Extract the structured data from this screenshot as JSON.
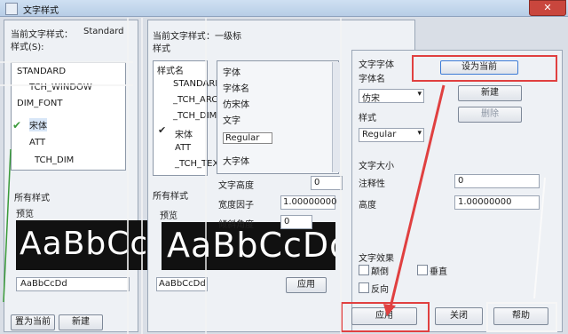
{
  "window": {
    "title": "文字样式",
    "close_glyph": "✕"
  },
  "left": {
    "current_label": "当前文字样式：",
    "current_value": "Standard",
    "styles_label": "样式(S):",
    "styles": [
      "STANDARD",
      "TCH_WINDOW",
      "DIM_FONT",
      "宋体",
      "ATT",
      "TCH_DIM"
    ],
    "filter_label": "所有样式",
    "preview_label": "预览",
    "preview_big": "AaBbCcI",
    "preview_small": "AaBbCcDd",
    "btn_left_a": "置为当前",
    "btn_left_b": "新建"
  },
  "mid": {
    "header": "当前文字样式：一级标",
    "styles_label": "样式",
    "list_header": "样式名",
    "styles": [
      "STANDARD",
      "_TCH_ARCH",
      "_TCH_DIM",
      "宋体",
      "ATT",
      "_TCH_TEXT"
    ],
    "filter_label": "所有样式",
    "preview_label": "预览",
    "preview_big": "AaBbCcDd",
    "preview_small": "AaBbCcDd",
    "font_items": [
      "字体",
      "字体名",
      "仿宋体",
      "文字",
      "Regular",
      "大字体",
      "文字高度",
      "宽度因子",
      "倾斜角度"
    ],
    "height_value": "0",
    "width_value": "1.00000000",
    "width_label": "宽度因子",
    "oblique_label": "倾斜角度",
    "oblique_value": "0",
    "small_btn": "应用"
  },
  "right": {
    "font_section": "文字字体",
    "font_name_label": "字体名",
    "font_name_value": "仿宋",
    "style_label": "样式",
    "style_value": "Regular",
    "top_button": "设为当前",
    "second_button": "新建",
    "third_button": "删除",
    "size_section": "文字大小",
    "annotative_label": "注释性",
    "height_label": "高度",
    "height_value": "0",
    "effect_section": "文字效果",
    "upside_down": "颠倒",
    "backwards": "反向",
    "vertical": "垂直",
    "ratio_value": "1.00000000",
    "apply_button": "应用",
    "close_button": "关闭",
    "help_button": "帮助"
  },
  "colors": {
    "accent": "#e04040",
    "selection": "#3d7bd6",
    "preview_bg": "#111111"
  }
}
